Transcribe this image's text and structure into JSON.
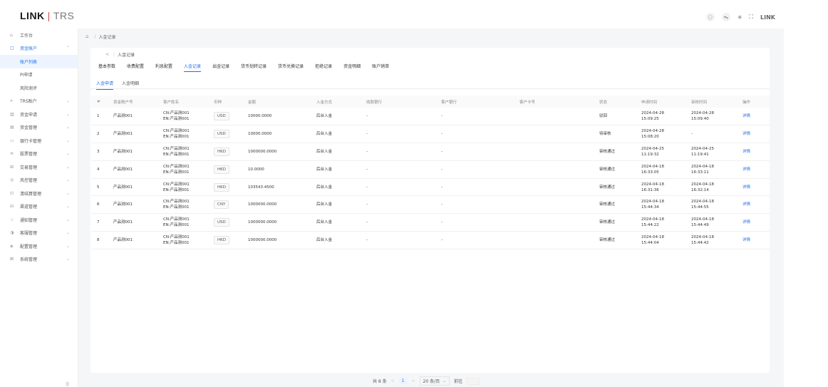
{
  "header": {
    "logo_brand": "LINK",
    "logo_sep": "|",
    "logo_sub": "TRS",
    "icons": [
      "bell-icon",
      "translate-icon",
      "theme-icon",
      "fullscreen-icon"
    ],
    "user_label": "LINK"
  },
  "sidebar": {
    "items": [
      {
        "label": "工作台",
        "icon": "home-icon"
      },
      {
        "label": "资金账户",
        "icon": "wallet-icon"
      },
      {
        "label": "账户列表"
      },
      {
        "label": "PI申请"
      },
      {
        "label": "风险测评"
      },
      {
        "label": "TRS账户",
        "icon": "trs-icon"
      },
      {
        "label": "资金申请",
        "icon": "apply-icon"
      },
      {
        "label": "资金管理",
        "icon": "fund-icon"
      },
      {
        "label": "银行卡管理",
        "icon": "card-icon"
      },
      {
        "label": "股票管理",
        "icon": "stock-icon"
      },
      {
        "label": "交易管理",
        "icon": "trade-icon"
      },
      {
        "label": "风控管理",
        "icon": "shield-icon"
      },
      {
        "label": "清结算管理",
        "icon": "settle-icon"
      },
      {
        "label": "渠道管理",
        "icon": "channel-icon"
      },
      {
        "label": "通知管理",
        "icon": "notice-icon"
      },
      {
        "label": "客服管理",
        "icon": "service-icon"
      },
      {
        "label": "配置管理",
        "icon": "config-icon"
      },
      {
        "label": "系统管理",
        "icon": "system-icon"
      }
    ]
  },
  "breadcrumb": {
    "current": "入金记录"
  },
  "page": {
    "back": "<",
    "title": "入金记录"
  },
  "tabs": [
    "基本参数",
    "收费配置",
    "利息配置",
    "入金记录",
    "出金记录",
    "货币划转记录",
    "货币兑换记录",
    "拒绝记录",
    "资金明细",
    "账户销单"
  ],
  "subtabs": [
    "入金申请",
    "入金明细"
  ],
  "table": {
    "headers": [
      "#",
      "资金账户号",
      "客户姓名",
      "币种",
      "金额",
      "入金方式",
      "收款银行",
      "客户银行",
      "客户卡号",
      "状态",
      "申请时间",
      "审核时间",
      "操作"
    ],
    "rows": [
      {
        "idx": "1",
        "account": "产品测001",
        "name_cn": "CN:产品测001",
        "name_en": "EN:产品测001",
        "currency": "USD",
        "amount": "10000.0000",
        "method": "后台入金",
        "recv_bank": "-",
        "cust_bank": "-",
        "card": "",
        "status": "驳回",
        "apply_date": "2024-04-28",
        "apply_time": "15:09:25",
        "review_date": "2024-04-28",
        "review_time": "15:09:40",
        "action": "详情"
      },
      {
        "idx": "2",
        "account": "产品测001",
        "name_cn": "CN:产品测001",
        "name_en": "EN:产品测001",
        "currency": "USD",
        "amount": "10000.0000",
        "method": "后台入金",
        "recv_bank": "-",
        "cust_bank": "-",
        "card": "",
        "status": "待审核",
        "apply_date": "2024-04-28",
        "apply_time": "15:08:20",
        "review_date": "-",
        "review_time": "",
        "action": "详情"
      },
      {
        "idx": "3",
        "account": "产品测001",
        "name_cn": "CN:产品测001",
        "name_en": "EN:产品测001",
        "currency": "HKD",
        "amount": "1000000.0000",
        "method": "后台入金",
        "recv_bank": "-",
        "cust_bank": "-",
        "card": "",
        "status": "审核通过",
        "apply_date": "2024-04-25",
        "apply_time": "11:19:32",
        "review_date": "2024-04-25",
        "review_time": "11:19:41",
        "action": "详情"
      },
      {
        "idx": "4",
        "account": "产品测001",
        "name_cn": "CN:产品测001",
        "name_en": "EN:产品测001",
        "currency": "HKD",
        "amount": "10.0000",
        "method": "后台入金",
        "recv_bank": "-",
        "cust_bank": "-",
        "card": "",
        "status": "审核通过",
        "apply_date": "2024-04-18",
        "apply_time": "16:33:05",
        "review_date": "2024-04-18",
        "review_time": "16:33:11",
        "action": "详情"
      },
      {
        "idx": "5",
        "account": "产品测001",
        "name_cn": "CN:产品测001",
        "name_en": "EN:产品测001",
        "currency": "HKD",
        "amount": "103543.4500",
        "method": "后台入金",
        "recv_bank": "-",
        "cust_bank": "-",
        "card": "",
        "status": "审核通过",
        "apply_date": "2024-04-18",
        "apply_time": "16:31:36",
        "review_date": "2024-04-18",
        "review_time": "16:32:14",
        "action": "详情"
      },
      {
        "idx": "6",
        "account": "产品测001",
        "name_cn": "CN:产品测001",
        "name_en": "EN:产品测001",
        "currency": "CNY",
        "amount": "1000000.0000",
        "method": "后台入金",
        "recv_bank": "-",
        "cust_bank": "-",
        "card": "",
        "status": "审核通过",
        "apply_date": "2024-04-18",
        "apply_time": "15:44:34",
        "review_date": "2024-04-18",
        "review_time": "15:44:55",
        "action": "详情"
      },
      {
        "idx": "7",
        "account": "产品测001",
        "name_cn": "CN:产品测001",
        "name_en": "EN:产品测001",
        "currency": "USD",
        "amount": "1000000.0000",
        "method": "后台入金",
        "recv_bank": "-",
        "cust_bank": "-",
        "card": "",
        "status": "审核通过",
        "apply_date": "2024-04-18",
        "apply_time": "15:44:22",
        "review_date": "2024-04-18",
        "review_time": "15:44:49",
        "action": "详情"
      },
      {
        "idx": "8",
        "account": "产品测001",
        "name_cn": "CN:产品测001",
        "name_en": "EN:产品测001",
        "currency": "HKD",
        "amount": "1000000.0000",
        "method": "后台入金",
        "recv_bank": "-",
        "cust_bank": "-",
        "card": "",
        "status": "审核通过",
        "apply_date": "2024-04-18",
        "apply_time": "15:44:04",
        "review_date": "2024-04-18",
        "review_time": "15:44:42",
        "action": "详情"
      }
    ]
  },
  "pagination": {
    "total": "共 8 条",
    "prev": "<",
    "page": "1",
    "next": ">",
    "page_size": "20 条/页",
    "goto": "前往"
  },
  "colors": {
    "accent": "#1c6fef",
    "logo_sep": "#d05050"
  }
}
